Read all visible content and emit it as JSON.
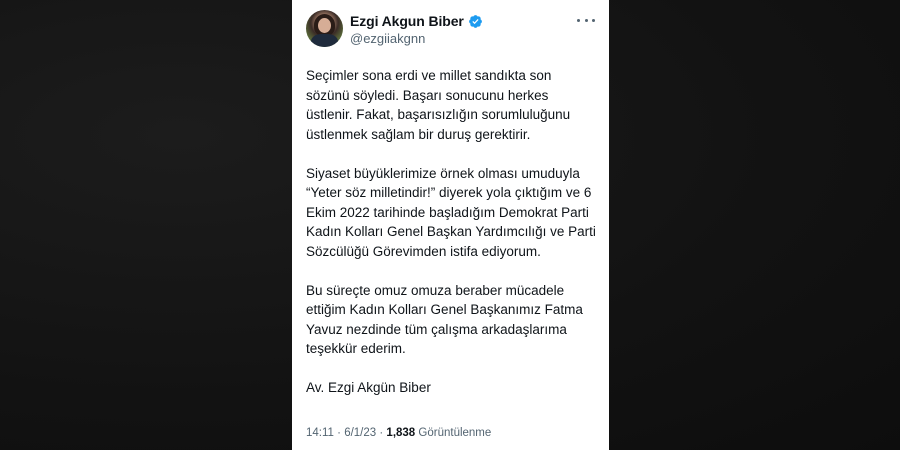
{
  "tweet": {
    "author": {
      "display_name": "Ezgi Akgun Biber",
      "handle": "@ezgiiakgnn",
      "verified": true,
      "verified_color": "#1d9bf0"
    },
    "paragraphs": [
      "Seçimler sona erdi ve millet sandıkta son sözünü söyledi. Başarı sonucunu herkes üstlenir. Fakat, başarısızlığın sorumluluğunu üstlenmek sağlam bir duruş gerektirir.",
      "Siyaset büyüklerimize örnek olması umuduyla “Yeter söz milletindir!” diyerek yola çıktığım ve 6 Ekim 2022 tarihinde başladığım Demokrat Parti Kadın Kolları Genel Başkan Yardımcılığı ve Parti Sözcülüğü Görevimden istifa ediyorum.",
      "Bu süreçte omuz omuza beraber mücadele ettiğim Kadın Kolları Genel Başkanımız Fatma Yavuz nezdinde tüm çalışma arkadaşlarıma teşekkür ederim.",
      "Av. Ezgi Akgün Biber"
    ],
    "meta": {
      "time": "14:11",
      "separator": "·",
      "date": "6/1/23",
      "views_count": "1,838",
      "views_label": "Görüntülenme"
    }
  },
  "colors": {
    "background": "#141414",
    "card": "#ffffff",
    "text_primary": "#0f1419",
    "text_secondary": "#536471"
  },
  "icons": {
    "verified": "verified-badge-icon",
    "more": "more-dots-icon"
  }
}
